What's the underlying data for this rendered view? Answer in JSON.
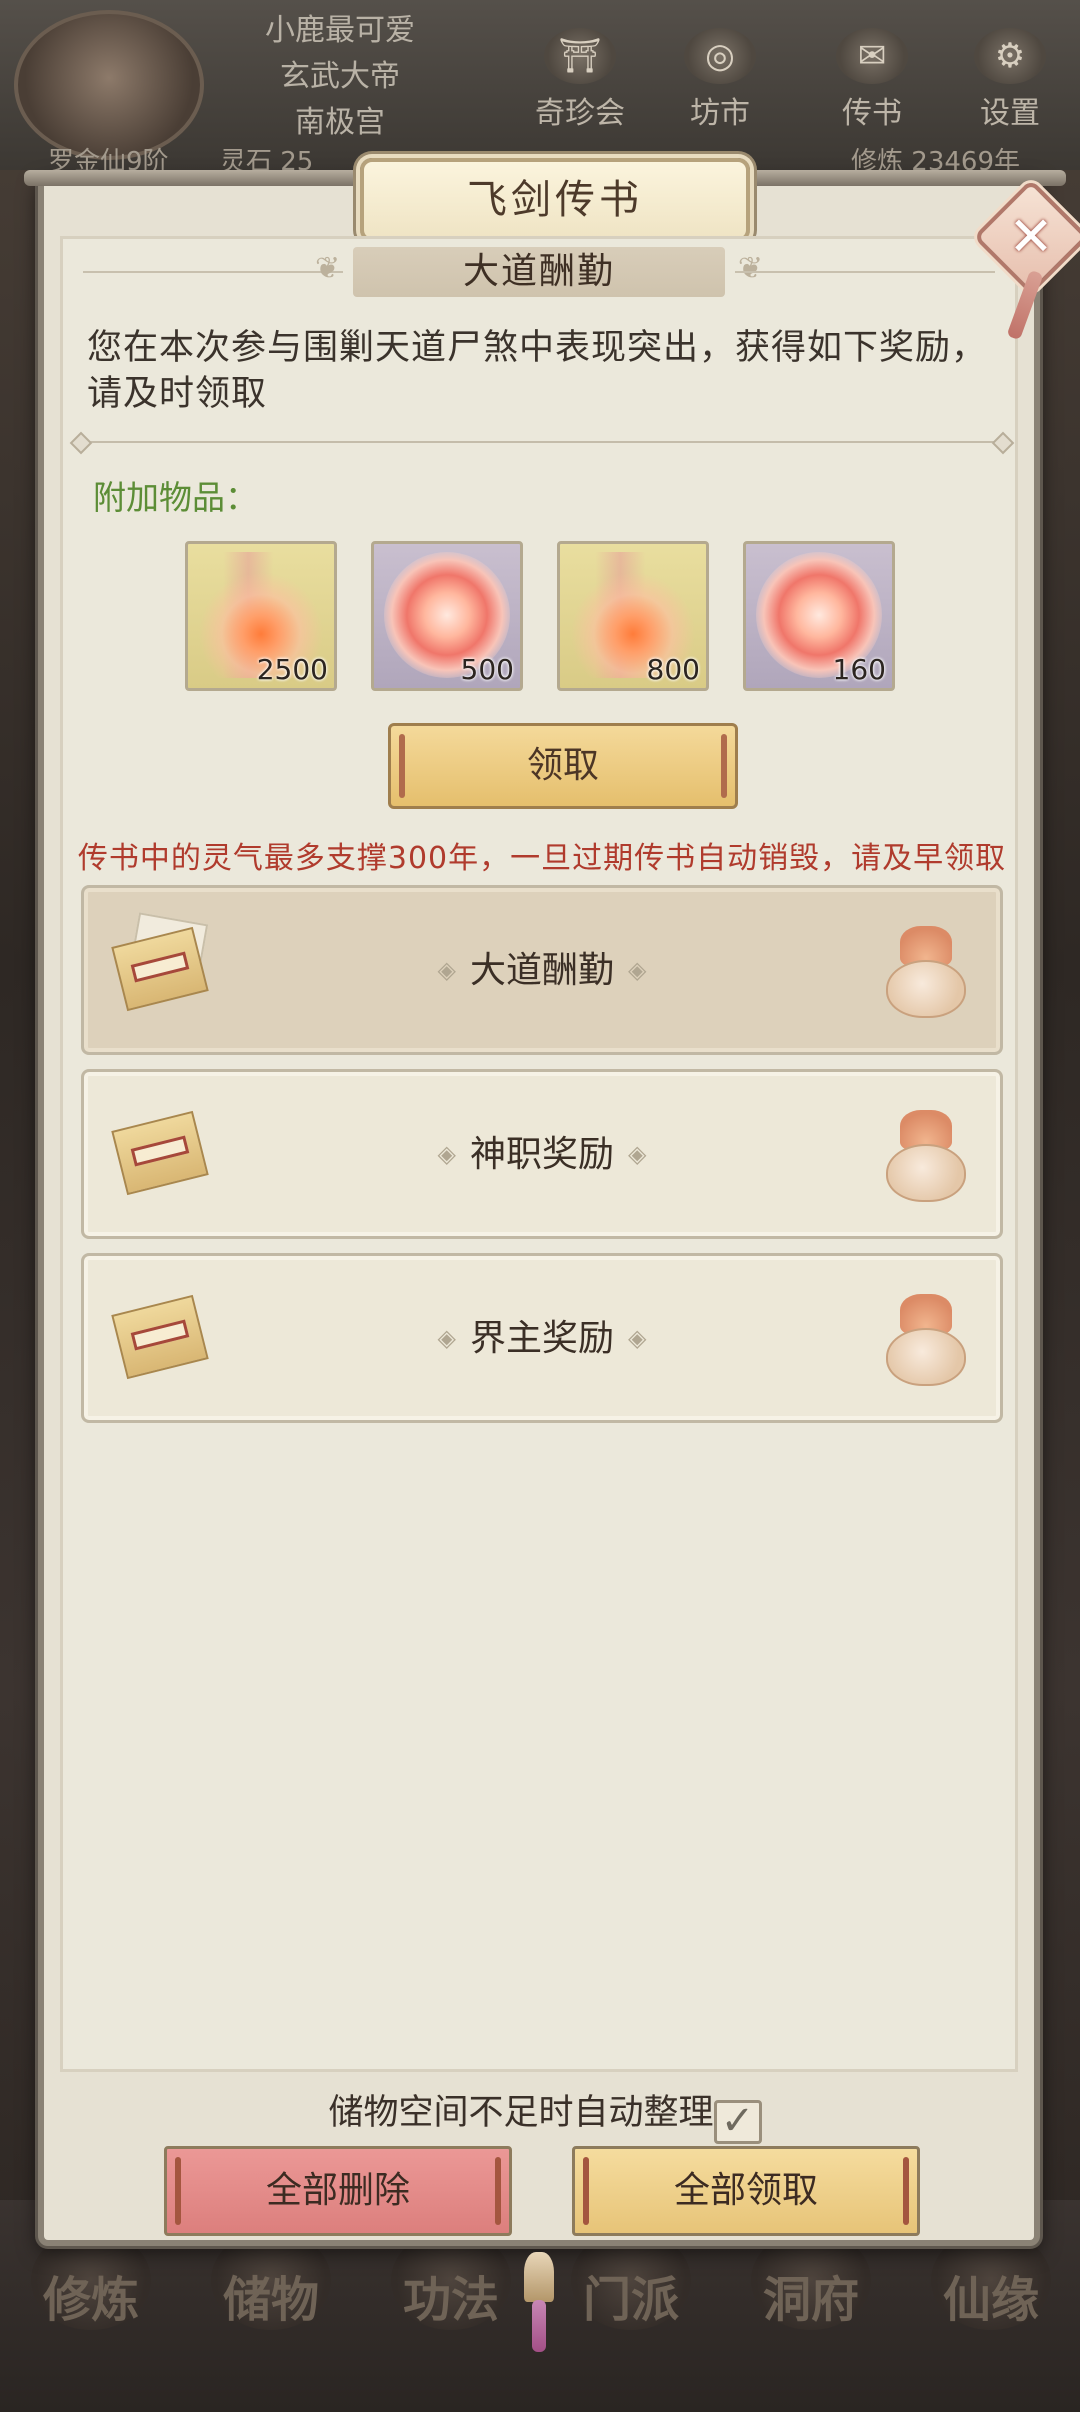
{
  "player": {
    "name": "小鹿最可爱",
    "title": "玄武大帝",
    "sect": "南极宫",
    "rank": "罗金仙9阶",
    "stones": "灵石 25",
    "cultivation": "修炼 23469年"
  },
  "top_menu": [
    "奇珍会",
    "坊市",
    "传书",
    "设置"
  ],
  "bottom_nav": [
    "修炼",
    "储物",
    "功法",
    "门派",
    "洞府",
    "仙缘"
  ],
  "dialog": {
    "title": "飞剑传书",
    "close_glyph": "✕"
  },
  "mail": {
    "subject": "大道酬勤",
    "message": "您在本次参与围剿天道尸煞中表现突出，获得如下奖励，请及时领取",
    "attachments_label": "附加物品：",
    "attachments": [
      {
        "icon": "talisman-scroll-icon",
        "quantity": "2500",
        "rarity_color": "#e3d693"
      },
      {
        "icon": "spirit-orb-icon",
        "quantity": "500",
        "rarity_color": "#bdb3c6"
      },
      {
        "icon": "talisman-scroll-icon",
        "quantity": "800",
        "rarity_color": "#e3d693"
      },
      {
        "icon": "spirit-orb-icon",
        "quantity": "160",
        "rarity_color": "#bdb3c6"
      }
    ],
    "claim_label": "领取",
    "warning": "传书中的灵气最多支撑300年，一旦过期传书自动销毁，请及早领取"
  },
  "mail_list": [
    {
      "title": "大道酬勤",
      "selected": true
    },
    {
      "title": "神职奖励",
      "selected": false
    },
    {
      "title": "界主奖励",
      "selected": false
    }
  ],
  "footer": {
    "auto_sort_label": "储物空间不足时自动整理",
    "auto_sort_checked": true,
    "check_glyph": "✓",
    "delete_all_label": "全部删除",
    "claim_all_label": "全部领取"
  },
  "colors": {
    "accent_green": "#5c8d36",
    "warning_red": "#b03b2d",
    "delete_button": "#e38b89",
    "claim_button": "#eecf8b"
  }
}
